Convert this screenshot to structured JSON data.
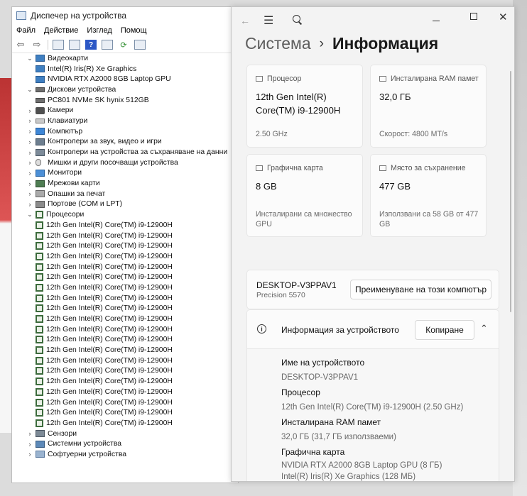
{
  "device_manager": {
    "title": "Диспечер на устройства",
    "menu": [
      "Файл",
      "Действие",
      "Изглед",
      "Помощ"
    ],
    "toolbar_help": "?",
    "tree": [
      {
        "label": "Видеокарти",
        "level": 1,
        "expander": "⌄",
        "icon": "display-adapter-icon",
        "cls": "display"
      },
      {
        "label": "Intel(R) Iris(R) Xe Graphics",
        "level": 2,
        "expander": "",
        "icon": "display-adapter-icon",
        "cls": "display"
      },
      {
        "label": "NVIDIA RTX A2000 8GB Laptop GPU",
        "level": 2,
        "expander": "",
        "icon": "display-adapter-icon",
        "cls": "display"
      },
      {
        "label": "Дискови устройства",
        "level": 1,
        "expander": "⌄",
        "icon": "disk-drive-icon",
        "cls": "disk"
      },
      {
        "label": "PC801 NVMe SK hynix 512GB",
        "level": 2,
        "expander": "",
        "icon": "disk-drive-icon",
        "cls": "disk"
      },
      {
        "label": "Камери",
        "level": 1,
        "expander": "›",
        "icon": "camera-icon",
        "cls": "cam"
      },
      {
        "label": "Клавиатури",
        "level": 1,
        "expander": "›",
        "icon": "keyboard-icon",
        "cls": "kbd"
      },
      {
        "label": "Компютър",
        "level": 1,
        "expander": "›",
        "icon": "computer-icon",
        "cls": "comp"
      },
      {
        "label": "Контролери за звук, видео и игри",
        "level": 1,
        "expander": "›",
        "icon": "sound-controller-icon",
        "cls": "snd"
      },
      {
        "label": "Контролери на устройства за съхраняване на данни",
        "level": 1,
        "expander": "›",
        "icon": "storage-controller-icon",
        "cls": "stor"
      },
      {
        "label": "Мишки и други посочващи устройства",
        "level": 1,
        "expander": "›",
        "icon": "mouse-icon",
        "cls": "mouse"
      },
      {
        "label": "Монитори",
        "level": 1,
        "expander": "›",
        "icon": "monitor-icon",
        "cls": "mon"
      },
      {
        "label": "Мрежови карти",
        "level": 1,
        "expander": "›",
        "icon": "network-adapter-icon",
        "cls": "net"
      },
      {
        "label": "Опашки за печат",
        "level": 1,
        "expander": "›",
        "icon": "print-queue-icon",
        "cls": "print"
      },
      {
        "label": "Портове (COM и LPT)",
        "level": 1,
        "expander": "›",
        "icon": "port-icon",
        "cls": "port"
      },
      {
        "label": "Процесори",
        "level": 1,
        "expander": "⌄",
        "icon": "processor-icon",
        "cls": "cpu"
      },
      {
        "label": "12th Gen Intel(R) Core(TM) i9-12900H",
        "level": 2,
        "expander": "",
        "icon": "processor-icon",
        "cls": "cpu"
      },
      {
        "label": "12th Gen Intel(R) Core(TM) i9-12900H",
        "level": 2,
        "expander": "",
        "icon": "processor-icon",
        "cls": "cpu"
      },
      {
        "label": "12th Gen Intel(R) Core(TM) i9-12900H",
        "level": 2,
        "expander": "",
        "icon": "processor-icon",
        "cls": "cpu"
      },
      {
        "label": "12th Gen Intel(R) Core(TM) i9-12900H",
        "level": 2,
        "expander": "",
        "icon": "processor-icon",
        "cls": "cpu"
      },
      {
        "label": "12th Gen Intel(R) Core(TM) i9-12900H",
        "level": 2,
        "expander": "",
        "icon": "processor-icon",
        "cls": "cpu"
      },
      {
        "label": "12th Gen Intel(R) Core(TM) i9-12900H",
        "level": 2,
        "expander": "",
        "icon": "processor-icon",
        "cls": "cpu"
      },
      {
        "label": "12th Gen Intel(R) Core(TM) i9-12900H",
        "level": 2,
        "expander": "",
        "icon": "processor-icon",
        "cls": "cpu"
      },
      {
        "label": "12th Gen Intel(R) Core(TM) i9-12900H",
        "level": 2,
        "expander": "",
        "icon": "processor-icon",
        "cls": "cpu"
      },
      {
        "label": "12th Gen Intel(R) Core(TM) i9-12900H",
        "level": 2,
        "expander": "",
        "icon": "processor-icon",
        "cls": "cpu"
      },
      {
        "label": "12th Gen Intel(R) Core(TM) i9-12900H",
        "level": 2,
        "expander": "",
        "icon": "processor-icon",
        "cls": "cpu"
      },
      {
        "label": "12th Gen Intel(R) Core(TM) i9-12900H",
        "level": 2,
        "expander": "",
        "icon": "processor-icon",
        "cls": "cpu"
      },
      {
        "label": "12th Gen Intel(R) Core(TM) i9-12900H",
        "level": 2,
        "expander": "",
        "icon": "processor-icon",
        "cls": "cpu"
      },
      {
        "label": "12th Gen Intel(R) Core(TM) i9-12900H",
        "level": 2,
        "expander": "",
        "icon": "processor-icon",
        "cls": "cpu"
      },
      {
        "label": "12th Gen Intel(R) Core(TM) i9-12900H",
        "level": 2,
        "expander": "",
        "icon": "processor-icon",
        "cls": "cpu"
      },
      {
        "label": "12th Gen Intel(R) Core(TM) i9-12900H",
        "level": 2,
        "expander": "",
        "icon": "processor-icon",
        "cls": "cpu"
      },
      {
        "label": "12th Gen Intel(R) Core(TM) i9-12900H",
        "level": 2,
        "expander": "",
        "icon": "processor-icon",
        "cls": "cpu"
      },
      {
        "label": "12th Gen Intel(R) Core(TM) i9-12900H",
        "level": 2,
        "expander": "",
        "icon": "processor-icon",
        "cls": "cpu"
      },
      {
        "label": "12th Gen Intel(R) Core(TM) i9-12900H",
        "level": 2,
        "expander": "",
        "icon": "processor-icon",
        "cls": "cpu"
      },
      {
        "label": "12th Gen Intel(R) Core(TM) i9-12900H",
        "level": 2,
        "expander": "",
        "icon": "processor-icon",
        "cls": "cpu"
      },
      {
        "label": "12th Gen Intel(R) Core(TM) i9-12900H",
        "level": 2,
        "expander": "",
        "icon": "processor-icon",
        "cls": "cpu"
      },
      {
        "label": "Сензори",
        "level": 1,
        "expander": "›",
        "icon": "sensor-icon",
        "cls": "sens"
      },
      {
        "label": "Системни устройства",
        "level": 1,
        "expander": "›",
        "icon": "system-device-icon",
        "cls": "sys"
      },
      {
        "label": "Софтуерни устройства",
        "level": 1,
        "expander": "›",
        "icon": "software-device-icon",
        "cls": "sw"
      }
    ]
  },
  "settings": {
    "breadcrumb_parent": "Система",
    "breadcrumb_sep": "›",
    "breadcrumb_current": "Информация",
    "cards": {
      "cpu": {
        "label": "Процесор",
        "value": "12th Gen Intel(R) Core(TM) i9-12900H",
        "sub": "2.50 GHz"
      },
      "ram": {
        "label": "Инсталирана RAM памет",
        "value": "32,0 ГБ",
        "sub": "Скорост: 4800 MT/s"
      },
      "gpu": {
        "label": "Графична карта",
        "value": "8 GB",
        "sub": "Инсталирани са множество GPU"
      },
      "storage": {
        "label": "Място за съхранение",
        "value": "477 GB",
        "sub": "Използвани са 58 GB от 477 GB"
      }
    },
    "device": {
      "name": "DESKTOP-V3PPAV1",
      "model": "Precision 5570",
      "rename_label": "Преименуване на този компютър"
    },
    "specs": {
      "title": "Информация за устройството",
      "copy_label": "Копиране",
      "device_name_label": "Име на устройството",
      "device_name_value": "DESKTOP-V3PPAV1",
      "processor_label": "Процесор",
      "processor_value": "12th Gen Intel(R) Core(TM) i9-12900H (2.50 GHz)",
      "ram_label": "Инсталирана RAM памет",
      "ram_value": "32,0 ГБ (31,7 ГБ използваеми)",
      "gpu_label": "Графична карта",
      "gpu_value_1": "NVIDIA RTX A2000 8GB Laptop GPU (8 ГБ)",
      "gpu_value_2": "Intel(R) Iris(R) Xe Graphics (128 МБ)"
    }
  }
}
